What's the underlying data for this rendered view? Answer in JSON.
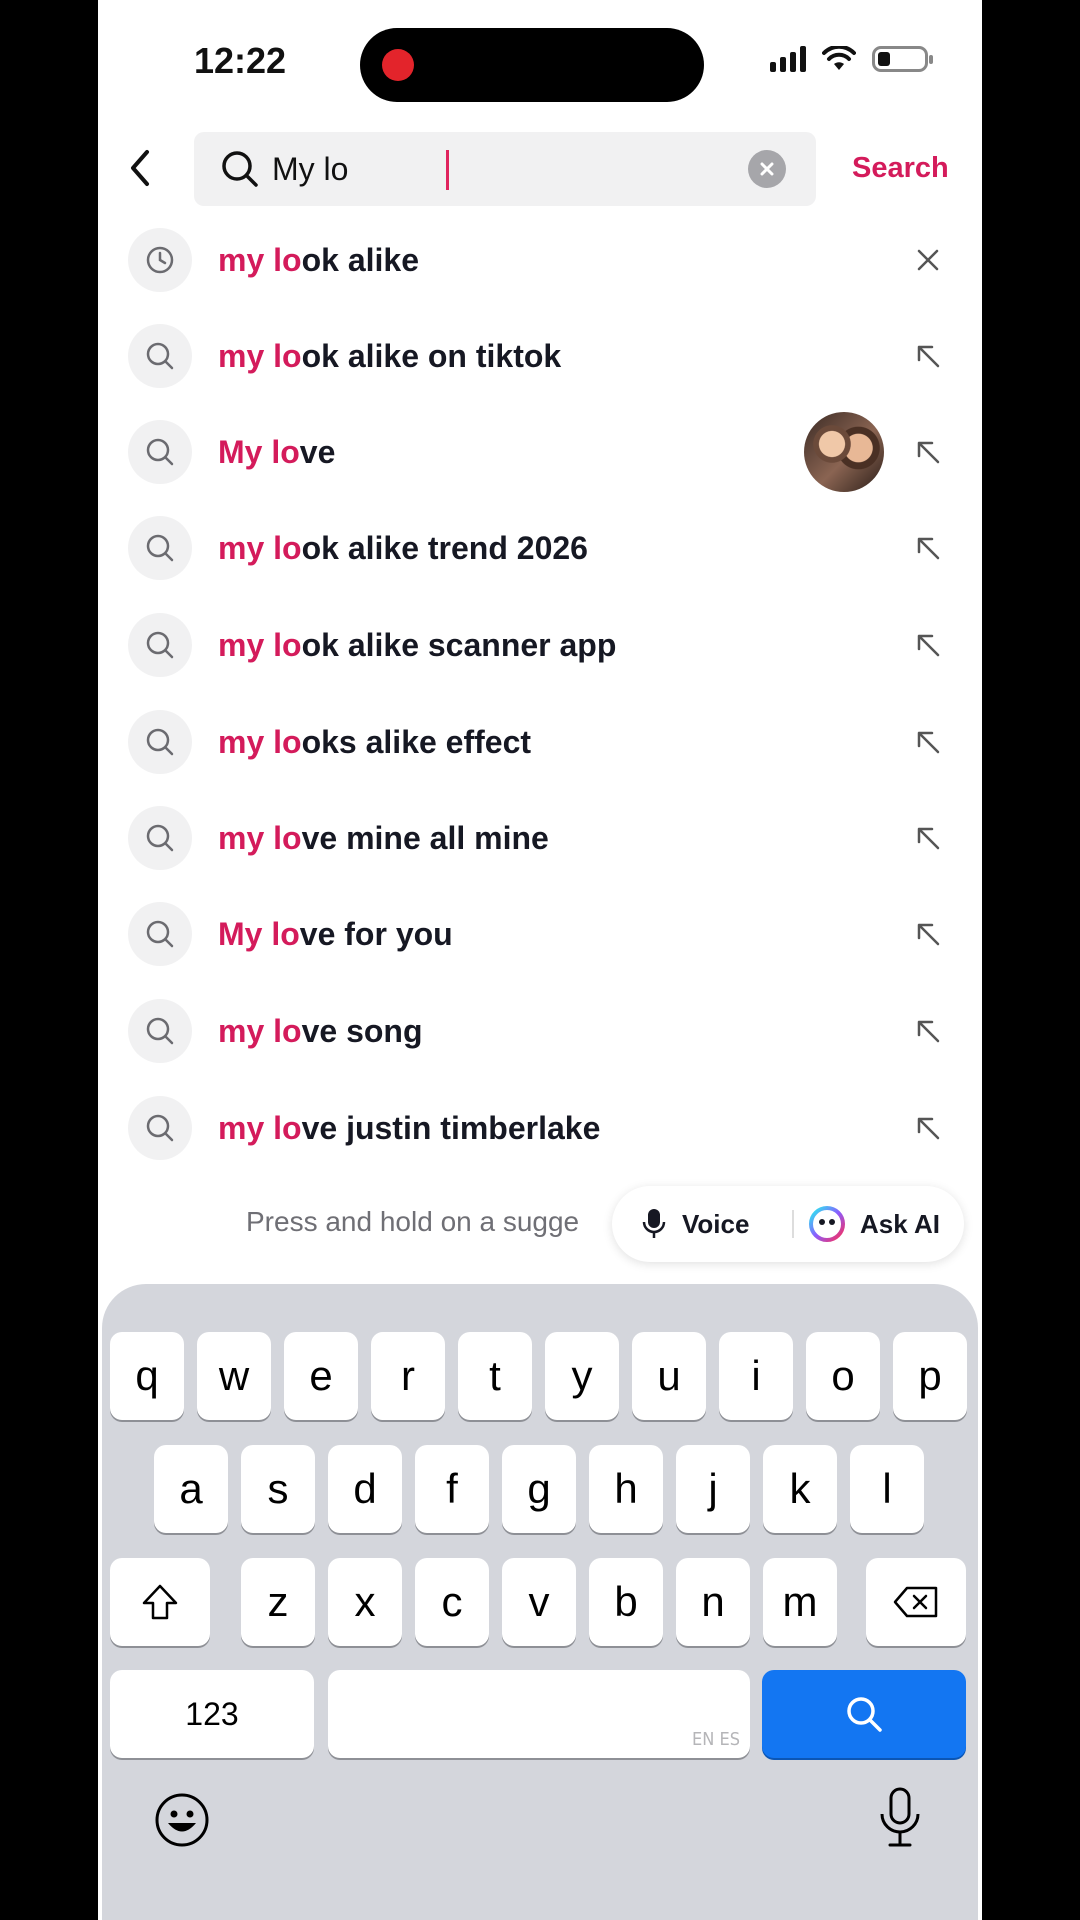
{
  "status_bar": {
    "time": "12:22"
  },
  "search": {
    "query": "My lo",
    "submit_label": "Search"
  },
  "suggestions": [
    {
      "highlight": "my lo",
      "rest": "ok alike",
      "type": "history",
      "action": "remove"
    },
    {
      "highlight": "my lo",
      "rest": "ok alike on tiktok",
      "type": "search",
      "action": "fill"
    },
    {
      "highlight": "My lo",
      "rest": "ve",
      "type": "search",
      "action": "fill",
      "has_thumbnail": true
    },
    {
      "highlight": "my lo",
      "rest": "ok alike trend 2026",
      "type": "search",
      "action": "fill"
    },
    {
      "highlight": "my lo",
      "rest": "ok alike scanner app",
      "type": "search",
      "action": "fill"
    },
    {
      "highlight": "my lo",
      "rest": "oks alike effect",
      "type": "search",
      "action": "fill"
    },
    {
      "highlight": "my lo",
      "rest": "ve mine all mine",
      "type": "search",
      "action": "fill"
    },
    {
      "highlight": "My lo",
      "rest": "ve for you",
      "type": "search",
      "action": "fill"
    },
    {
      "highlight": "my lo",
      "rest": "ve song",
      "type": "search",
      "action": "fill"
    },
    {
      "highlight": "my lo",
      "rest": "ve justin timberlake",
      "type": "search",
      "action": "fill"
    }
  ],
  "hint": "Press and hold on a sugge",
  "quick_actions": {
    "voice_label": "Voice",
    "ask_ai_label": "Ask AI"
  },
  "keyboard": {
    "row1": [
      "q",
      "w",
      "e",
      "r",
      "t",
      "y",
      "u",
      "i",
      "o",
      "p"
    ],
    "row2": [
      "a",
      "s",
      "d",
      "f",
      "g",
      "h",
      "j",
      "k",
      "l"
    ],
    "row3": [
      "z",
      "x",
      "c",
      "v",
      "b",
      "n",
      "m"
    ],
    "numbers_label": "123",
    "space_lang": "EN ES"
  },
  "colors": {
    "accent": "#d41b5b",
    "keyboard_go": "#1376f2",
    "record_dot": "#e3242b"
  }
}
